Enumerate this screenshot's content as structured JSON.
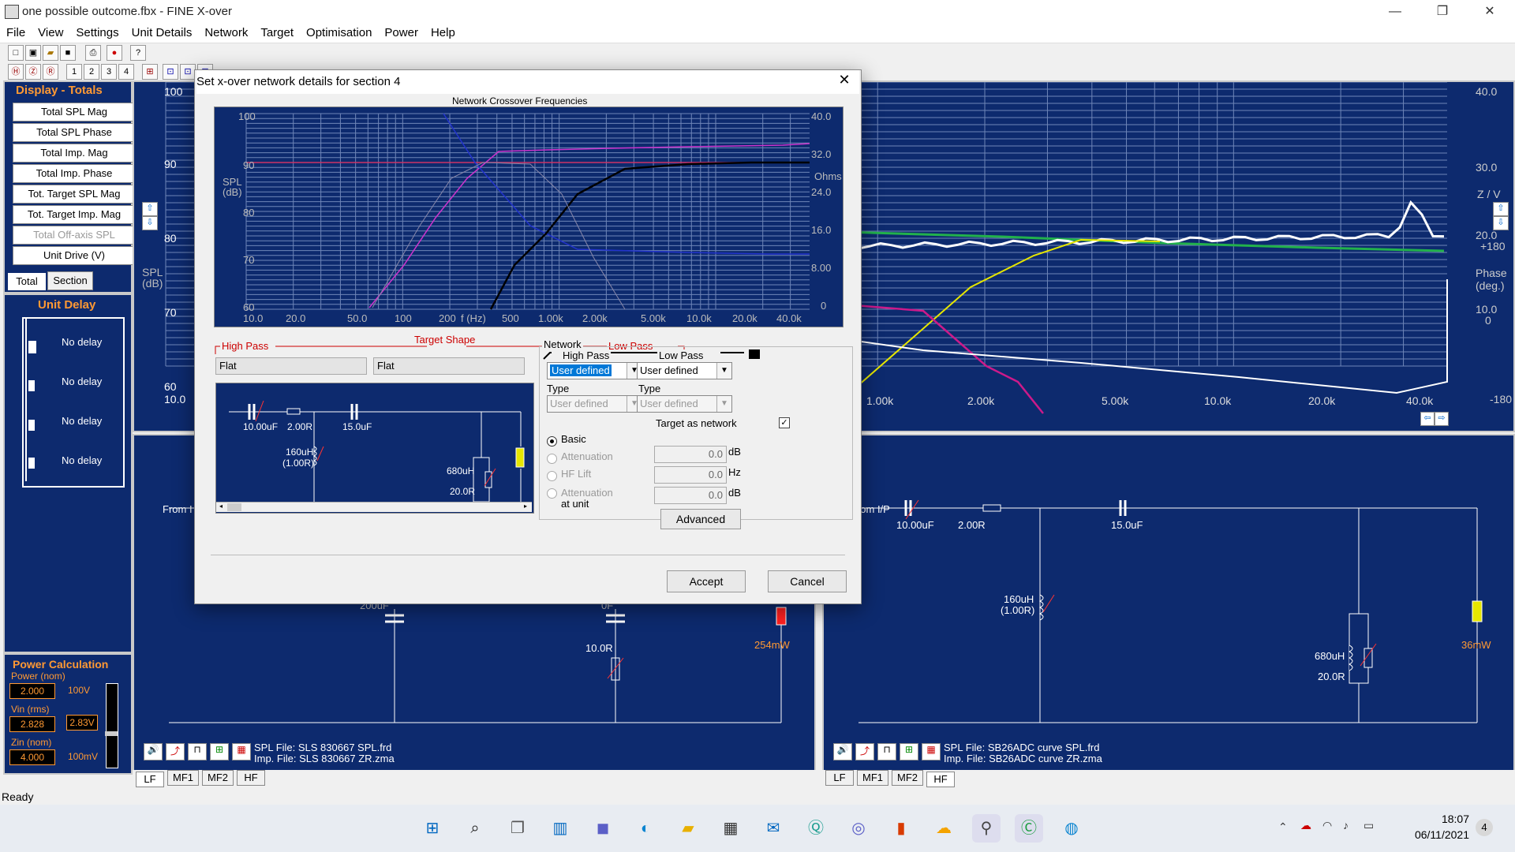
{
  "window": {
    "title": "one possible outcome.fbx - FINE X-over",
    "minimize": "—",
    "maximize": "❐",
    "close": "✕"
  },
  "menu": [
    "File",
    "View",
    "Settings",
    "Unit Details",
    "Network",
    "Target",
    "Optimisation",
    "Power",
    "Help"
  ],
  "sidebar": {
    "display_title": "Display - Totals",
    "buttons": [
      "Total SPL Mag",
      "Total SPL Phase",
      "Total Imp. Mag",
      "Total Imp. Phase",
      "Tot. Target SPL Mag",
      "Tot. Target Imp. Mag",
      "Total Off-axis SPL",
      "Unit Drive (V)"
    ],
    "tabs": [
      "Total",
      "Section"
    ],
    "unit_delay_title": "Unit Delay",
    "delays": [
      "No delay",
      "No delay",
      "No delay",
      "No delay"
    ],
    "power_title": "Power Calculation",
    "power_label": "Power (nom)",
    "power_value": "2.000",
    "power_scale": "100V",
    "vin_label": "Vin (rms)",
    "vin_value": "2.828",
    "vin_scale": "2.83V",
    "zin_label": "Zin (nom)",
    "zin_value": "4.000",
    "zin_scale": "100mV"
  },
  "main_chart": {
    "left_axis": [
      "100",
      "90",
      "80",
      "70",
      "60"
    ],
    "left_axis_bottom": "10.0",
    "right_axis": [
      "40.0",
      "30.0",
      "20.0",
      "10.0",
      "0"
    ],
    "right_label": "Z / V",
    "phase_label": "Phase\n(deg.)",
    "phase_axis": [
      "+180",
      "0",
      "-180"
    ],
    "spl_label": "SPL\n(dB)",
    "x_ticks": [
      "1.00k",
      "2.00k",
      "5.00k",
      "10.0k",
      "20.0k",
      "40.0k"
    ]
  },
  "bottom_left": {
    "from_label": "From I",
    "cap_label": "200uF",
    "cap2_label": "0F",
    "res_label": "10.0R",
    "power_label": "254mW",
    "spl_file": "SPL File: SLS 830667  SPL.frd",
    "imp_file": "Imp. File: SLS 830667  ZR.zma",
    "tabs": [
      "LF",
      "MF1",
      "MF2",
      "HF"
    ]
  },
  "bottom_right": {
    "from_label": "From I/P",
    "c1": "10.00uF",
    "r1": "2.00R",
    "c2": "15.0uF",
    "l1": "160uH",
    "l1r": "(1.00R)",
    "l2": "680uH",
    "r2": "20.0R",
    "power_label": "36mW",
    "spl_file": "SPL File: SB26ADC curve  SPL.frd",
    "imp_file": "Imp. File: SB26ADC curve  ZR.zma",
    "tabs": [
      "LF",
      "MF1",
      "MF2",
      "HF"
    ]
  },
  "dialog": {
    "title": "Set x-over network details for section 4",
    "chart_title": "Network Crossover Frequencies",
    "spl_axis": [
      "100",
      "90",
      "80",
      "70",
      "60"
    ],
    "spl_label": "SPL\n(dB)",
    "ohm_axis": [
      "40.0",
      "32.0",
      "24.0",
      "16.0",
      "8.00",
      "0"
    ],
    "ohm_label": "Ohms",
    "x_ticks": [
      "10.0",
      "20.0",
      "50.0",
      "100",
      "200",
      "f (Hz)",
      "500",
      "1.00k",
      "2.00k",
      "5.00k",
      "10.0k",
      "20.0k",
      "40.0k"
    ],
    "high_pass": "High Pass",
    "target_shape": "Target Shape",
    "low_pass": "Low Pass",
    "hp_shape": "Flat",
    "lp_shape": "Flat",
    "schematic": {
      "c1": "10.00uF",
      "r1": "2.00R",
      "c2": "15.0uF",
      "l1": "160uH",
      "l1r": "(1.00R)",
      "l2": "680uH",
      "r2": "20.0R"
    },
    "network_label": "Network",
    "net_hp": "High Pass",
    "net_lp": "Low Pass",
    "hp_value": "User defined",
    "lp_value": "User defined",
    "type_label": "Type",
    "type_label2": "Type",
    "hp_type": "User defined",
    "lp_type": "User defined",
    "target_as_network": "Target as network",
    "basic": "Basic",
    "attenuation": "Attenuation",
    "hf_lift": "HF Lift",
    "attenuation_unit": "Attenuation",
    "at_unit": "at unit",
    "att_val": "0.0",
    "att_unit": "dB",
    "hf_val": "0.0",
    "hf_unit": "Hz",
    "attu_val": "0.0",
    "attu_unit": "dB",
    "advanced": "Advanced",
    "accept": "Accept",
    "cancel": "Cancel"
  },
  "status": "Ready",
  "clock": {
    "time": "18:07",
    "date": "06/11/2021",
    "badge": "4"
  }
}
